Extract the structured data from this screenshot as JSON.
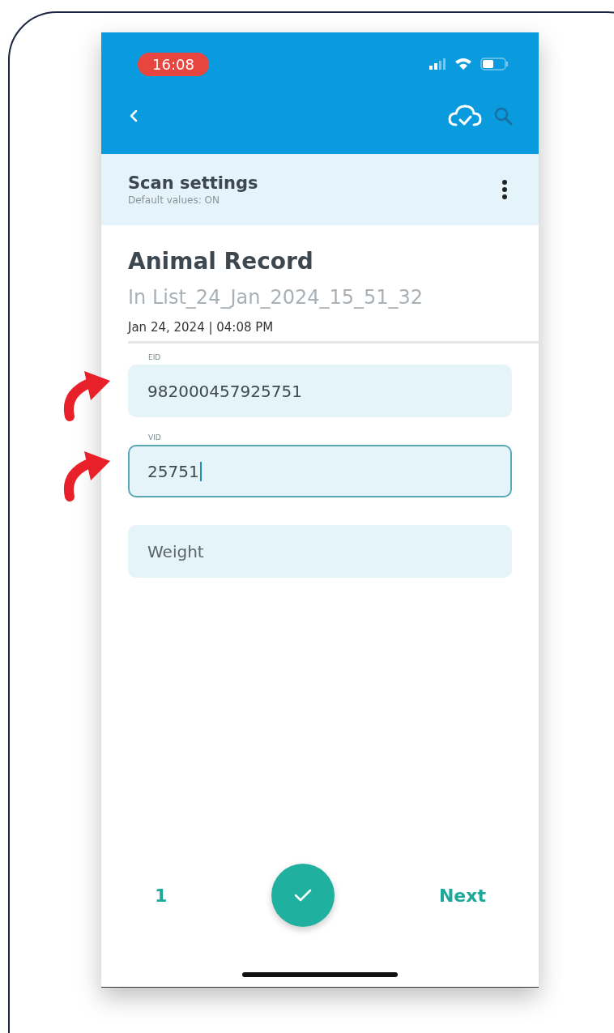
{
  "status_bar": {
    "time": "16:08"
  },
  "scan_settings": {
    "title": "Scan settings",
    "subtitle": "Default values: ON"
  },
  "record": {
    "title": "Animal Record",
    "list_name": "In List_24_Jan_2024_15_51_32",
    "timestamp": "Jan 24, 2024 | 04:08 PM"
  },
  "fields": [
    {
      "kind": "filled",
      "label": "EID",
      "value": "982000457925751",
      "focused": false,
      "annotated": true
    },
    {
      "kind": "filled",
      "label": "VID",
      "value": "25751",
      "focused": true,
      "annotated": true
    },
    {
      "kind": "empty",
      "placeholder": "Weight",
      "focused": false,
      "annotated": false
    }
  ],
  "footer": {
    "count": "1",
    "next": "Next"
  }
}
